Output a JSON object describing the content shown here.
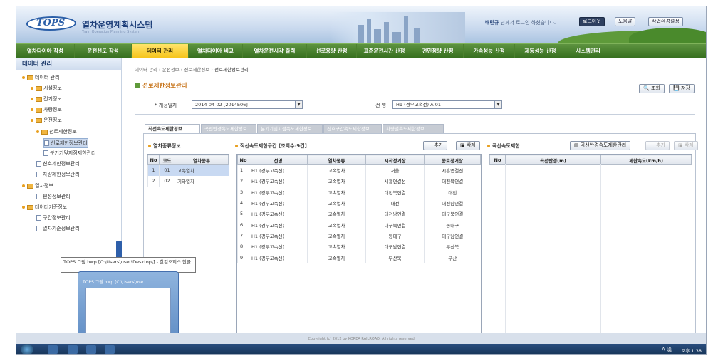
{
  "header": {
    "logo": "TOPS",
    "title": "열차운영계획시스템",
    "subtitle": "Train Operation Planning System",
    "user_name": "배민규",
    "user_msg": " 님께서 로그인 하셨습니다.",
    "logout": "로그아웃",
    "help": "도움말",
    "work_env": "작업환경설정"
  },
  "menus": [
    "열차다이아 작성",
    "운전선도 작성",
    "데이터 관리",
    "열차다이아 비교",
    "열차운전시각 출력",
    "선로용량 산정",
    "표준운전시간 산정",
    "견인정량 산정",
    "가속성능 산정",
    "제동성능 산정",
    "시스템관리"
  ],
  "active_menu": 2,
  "sidebar": {
    "title": "데이터 관리",
    "items": [
      {
        "label": "데이터 관리",
        "type": "folder"
      },
      {
        "label": "시설정보",
        "type": "folder"
      },
      {
        "label": "전기정보",
        "type": "folder"
      },
      {
        "label": "차량정보",
        "type": "folder"
      },
      {
        "label": "운전정보",
        "type": "folder"
      },
      {
        "label": "선로제한정보",
        "type": "folder"
      },
      {
        "label": "선로제한정보관리",
        "type": "doc"
      },
      {
        "label": "분기기및지점제한관리",
        "type": "doc"
      },
      {
        "label": "신호제한정보관리",
        "type": "doc"
      },
      {
        "label": "차량제한정보관리",
        "type": "doc"
      },
      {
        "label": "열차정보",
        "type": "folder"
      },
      {
        "label": "편성정보관리",
        "type": "doc"
      },
      {
        "label": "데이터기준정보",
        "type": "folder"
      },
      {
        "label": "구간정보관리",
        "type": "doc"
      },
      {
        "label": "열차기준정보관리",
        "type": "doc"
      }
    ]
  },
  "breadcrumb": [
    "데이터 관리",
    "운전정보",
    "선로제한정보",
    "선로제한정보관리"
  ],
  "page_title": "선로제한정보관리",
  "buttons": {
    "search": "조회",
    "save": "저장",
    "add": "추가",
    "delete": "삭제",
    "curve_mgmt": "곡선반경속도제한관리"
  },
  "filter": {
    "date_label": "* 개정일자",
    "date_value": "2014-04-02 [2014E06]",
    "line_label": "선 명",
    "line_value": "H1 (경부고속선) A-01"
  },
  "tabs": [
    "직선속도제한정보",
    "곡선반경속도제한정보",
    "분기기및지점속도제한정보",
    "신호구간속도제한정보",
    "차량별속도제한정보"
  ],
  "train_types": {
    "title": "열차종류정보",
    "columns": [
      "No",
      "코드",
      "열차종류"
    ],
    "rows": [
      [
        "1",
        "01",
        "고속열차"
      ],
      [
        "2",
        "02",
        "기타열차"
      ]
    ]
  },
  "straight": {
    "title": "직선속도제한구간 [조회수:9건]",
    "columns": [
      "No",
      "선명",
      "열차종류",
      "시작정거장",
      "종료정거장"
    ],
    "rows": [
      [
        "1",
        "H1 (경부고속선)",
        "고속열차",
        "서울",
        "시흥연결선"
      ],
      [
        "2",
        "H1 (경부고속선)",
        "고속열차",
        "시흥연결선",
        "대전북연결"
      ],
      [
        "3",
        "H1 (경부고속선)",
        "고속열차",
        "대전북연결",
        "대전"
      ],
      [
        "4",
        "H1 (경부고속선)",
        "고속열차",
        "대전",
        "대전남연결"
      ],
      [
        "5",
        "H1 (경부고속선)",
        "고속열차",
        "대전남연결",
        "대구북연결"
      ],
      [
        "6",
        "H1 (경부고속선)",
        "고속열차",
        "대구북연결",
        "동대구"
      ],
      [
        "7",
        "H1 (경부고속선)",
        "고속열차",
        "동대구",
        "대구남연결"
      ],
      [
        "8",
        "H1 (경부고속선)",
        "고속열차",
        "대구남연결",
        "부산북"
      ],
      [
        "9",
        "H1 (경부고속선)",
        "고속열차",
        "부산북",
        "부산"
      ]
    ]
  },
  "curve": {
    "title": "곡선속도제한",
    "columns": [
      "No",
      "곡선반경(m)",
      "제한속도(km/h)"
    ]
  },
  "taskbar_tip": "TOPS 그림.hwp [C:\\Users\\user\\Desktop\\] - 한컴오피스 한글",
  "popup_title": "TOPS 그림.hwp [C:\\Users\\use...",
  "footer": "Copyright (c) 2012 by KOREA RAILROAD. All rights reserved.",
  "tray_text": "A 漢",
  "clock": "오후 1:38"
}
